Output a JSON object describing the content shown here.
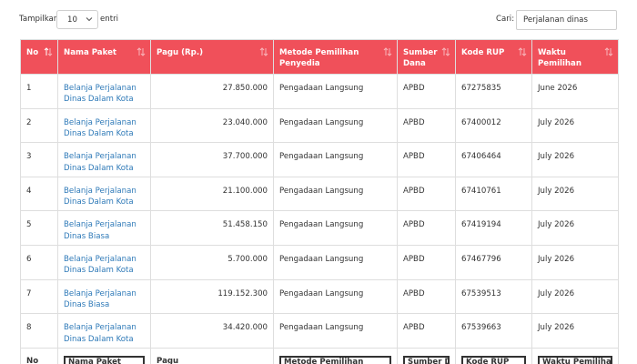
{
  "controls": {
    "show_label": "Tampilkan",
    "length_value": "10",
    "entries_label": "entri",
    "search_label": "Cari:",
    "search_value": "Perjalanan dinas"
  },
  "columns": [
    "No",
    "Nama Paket",
    "Pagu (Rp.)",
    "Metode Pemilihan Penyedia",
    "Sumber Dana",
    "Kode RUP",
    "Waktu Pemilihan"
  ],
  "rows": [
    {
      "no": "1",
      "nama": "Belanja Perjalanan Dinas Dalam Kota",
      "pagu": "27.850.000",
      "metode": "Pengadaan Langsung",
      "sumber": "APBD",
      "kode": "67275835",
      "waktu": "June 2026"
    },
    {
      "no": "2",
      "nama": "Belanja Perjalanan Dinas Dalam Kota",
      "pagu": "23.040.000",
      "metode": "Pengadaan Langsung",
      "sumber": "APBD",
      "kode": "67400012",
      "waktu": "July 2026"
    },
    {
      "no": "3",
      "nama": "Belanja Perjalanan Dinas Dalam Kota",
      "pagu": "37.700.000",
      "metode": "Pengadaan Langsung",
      "sumber": "APBD",
      "kode": "67406464",
      "waktu": "July 2026"
    },
    {
      "no": "4",
      "nama": "Belanja Perjalanan Dinas Dalam Kota",
      "pagu": "21.100.000",
      "metode": "Pengadaan Langsung",
      "sumber": "APBD",
      "kode": "67410761",
      "waktu": "July 2026"
    },
    {
      "no": "5",
      "nama": "Belanja Perjalanan Dinas Biasa",
      "pagu": "51.458.150",
      "metode": "Pengadaan Langsung",
      "sumber": "APBD",
      "kode": "67419194",
      "waktu": "July 2026"
    },
    {
      "no": "6",
      "nama": "Belanja Perjalanan Dinas Dalam Kota",
      "pagu": "5.700.000",
      "metode": "Pengadaan Langsung",
      "sumber": "APBD",
      "kode": "67467796",
      "waktu": "July 2026"
    },
    {
      "no": "7",
      "nama": "Belanja Perjalanan Dinas Biasa",
      "pagu": "119.152.300",
      "metode": "Pengadaan Langsung",
      "sumber": "APBD",
      "kode": "67539513",
      "waktu": "July 2026"
    },
    {
      "no": "8",
      "nama": "Belanja Perjalanan Dinas Dalam Kota",
      "pagu": "34.420.000",
      "metode": "Pengadaan Langsung",
      "sumber": "APBD",
      "kode": "67539663",
      "waktu": "July 2026"
    }
  ],
  "footer": {
    "no": "No",
    "nama": "Nama Paket",
    "pagu": "Pagu",
    "metode": "Metode Pemilihan",
    "sumber": "Sumber Dana",
    "kode": "Kode RUP",
    "waktu": "Waktu Pemilihan"
  },
  "colors": {
    "header_bg": "#f0505a",
    "link": "#2f7ab8"
  },
  "icons": {
    "sort": "sort-arrows-icon",
    "select": "chevron-down-icon"
  }
}
